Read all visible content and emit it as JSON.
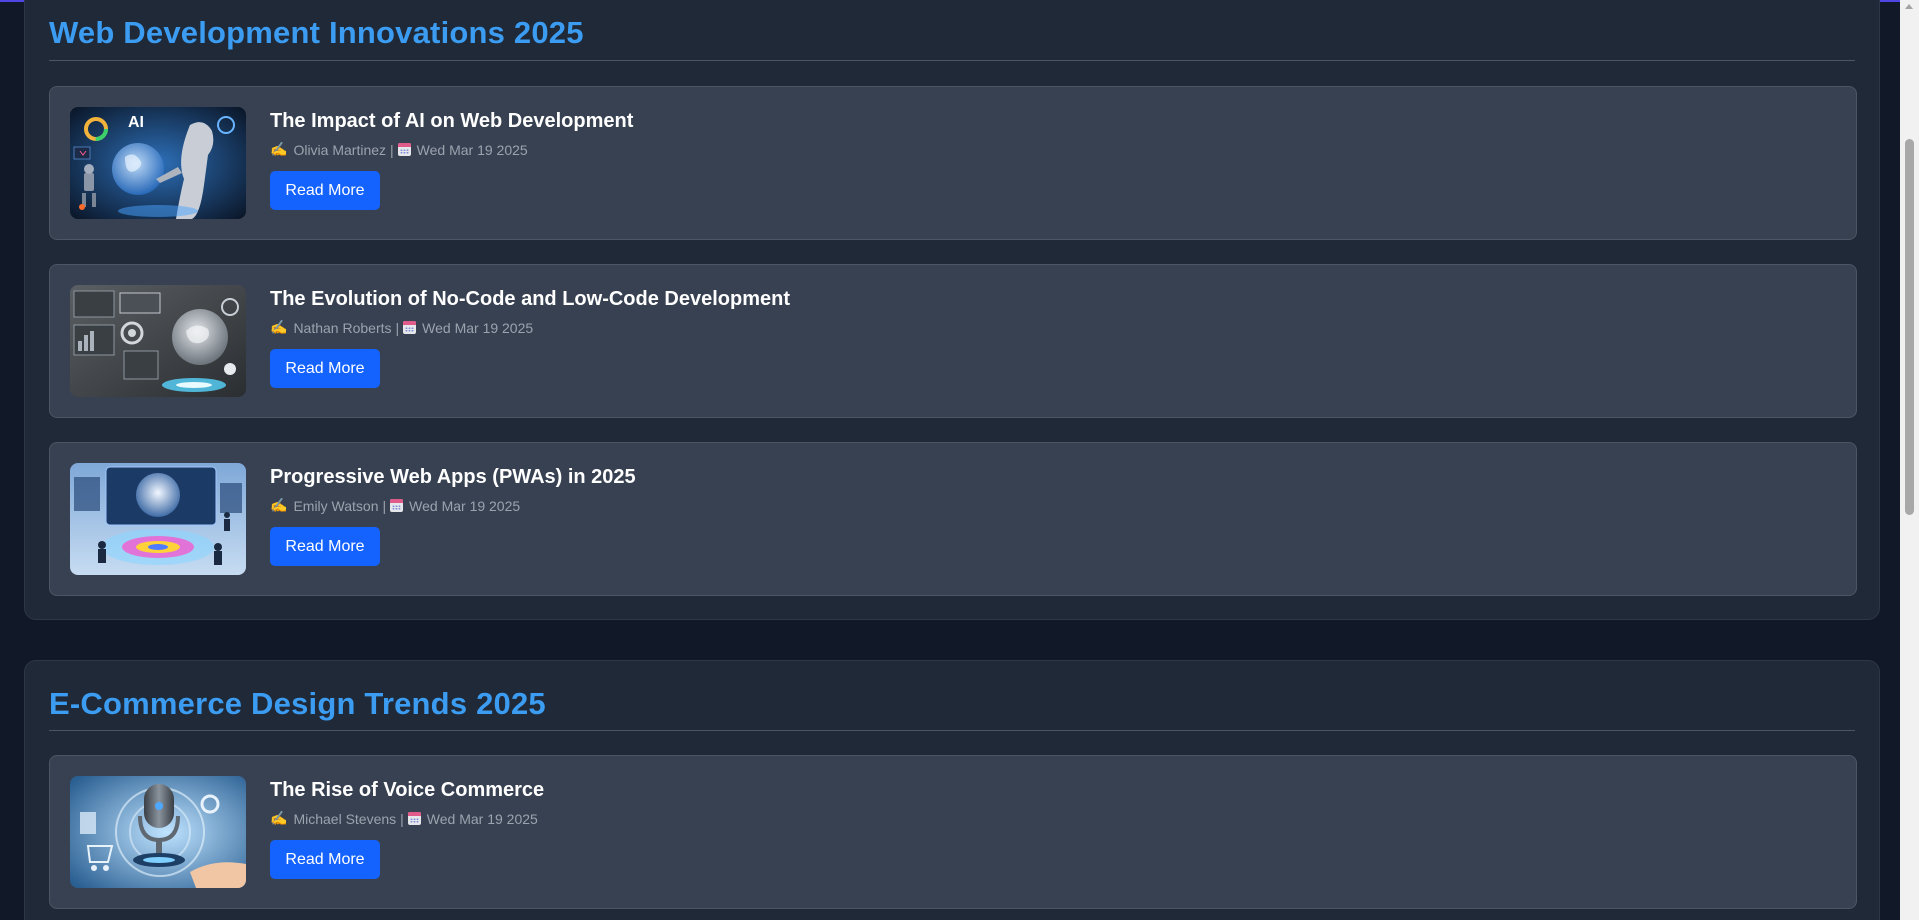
{
  "sections": [
    {
      "title": "Web Development Innovations 2025",
      "articles": [
        {
          "title": "The Impact of AI on Web Development",
          "author": "Olivia Martinez",
          "separator": "|",
          "date": "Wed Mar 19 2025",
          "button_label": "Read More",
          "thumb_text": "AI"
        },
        {
          "title": "The Evolution of No-Code and Low-Code Development",
          "author": "Nathan Roberts",
          "separator": "|",
          "date": "Wed Mar 19 2025",
          "button_label": "Read More"
        },
        {
          "title": "Progressive Web Apps (PWAs) in 2025",
          "author": "Emily Watson",
          "separator": "|",
          "date": "Wed Mar 19 2025",
          "button_label": "Read More"
        }
      ]
    },
    {
      "title": "E-Commerce Design Trends 2025",
      "articles": [
        {
          "title": "The Rise of Voice Commerce",
          "author": "Michael Stevens",
          "separator": "|",
          "date": "Wed Mar 19 2025",
          "button_label": "Read More"
        }
      ]
    }
  ],
  "icons": {
    "author": "writing-hand-icon",
    "date": "calendar-icon"
  },
  "colors": {
    "page_bg": "#111827",
    "section_bg": "#1f2937",
    "card_bg": "#374151",
    "heading": "#3b9cf1",
    "button": "#1563ff"
  },
  "scrollbar": {
    "position_fraction": 0.18
  }
}
